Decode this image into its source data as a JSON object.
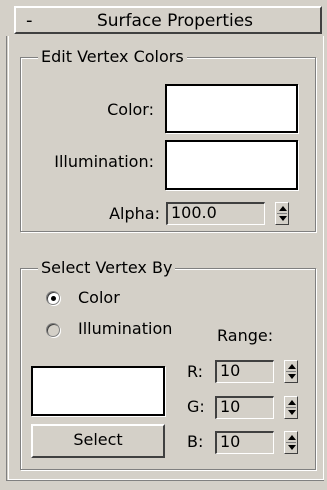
{
  "rollout": {
    "collapse_symbol": "-",
    "title": "Surface Properties"
  },
  "edit_vertex_colors": {
    "title": "Edit Vertex Colors",
    "color_label": "Color:",
    "illumination_label": "Illumination:",
    "alpha_label": "Alpha:",
    "alpha_value": "100.0",
    "color_swatch": "#ffffff",
    "illumination_swatch": "#ffffff"
  },
  "select_vertex_by": {
    "title": "Select Vertex By",
    "options": [
      {
        "label": "Color",
        "checked": true
      },
      {
        "label": "Illumination",
        "checked": false
      }
    ],
    "range_label": "Range:",
    "r_label": "R:",
    "r_value": "10",
    "g_label": "G:",
    "g_value": "10",
    "b_label": "B:",
    "b_value": "10",
    "select_swatch": "#ffffff",
    "select_button_label": "Select"
  }
}
